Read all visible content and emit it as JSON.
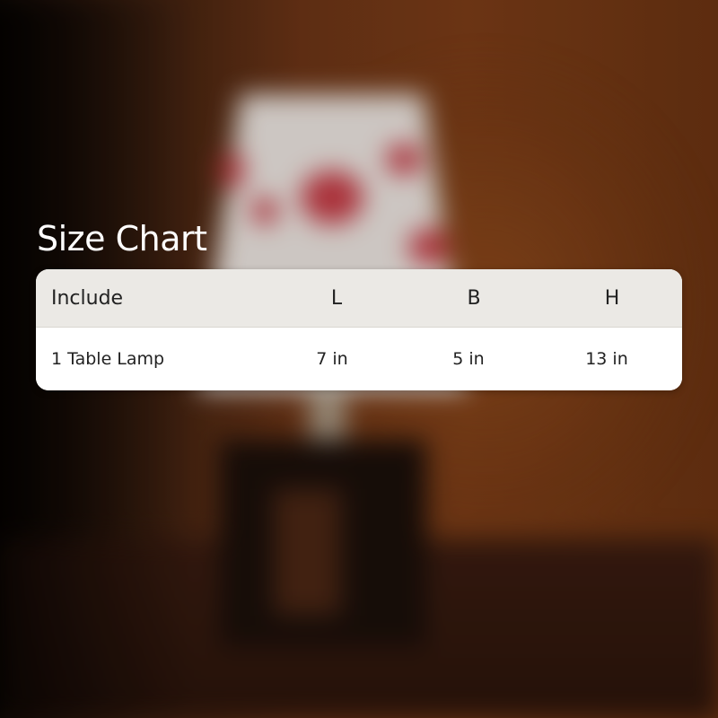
{
  "title": "Size Chart",
  "table": {
    "headers": [
      "Include",
      "L",
      "B",
      "H"
    ],
    "rows": [
      [
        "1 Table Lamp",
        "7 in",
        "5 in",
        "13 in"
      ]
    ]
  }
}
